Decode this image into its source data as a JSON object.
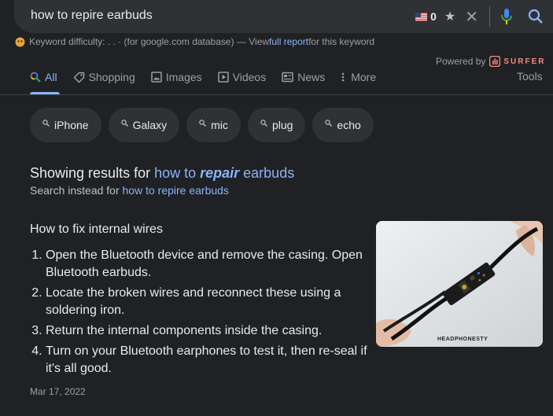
{
  "search": {
    "query": "how to repire earbuds",
    "keyword_count": "0"
  },
  "keyword_bar": {
    "prefix": "Keyword difficulty: . . · (for google.com database) — View ",
    "link": "full report",
    "suffix": " for this keyword"
  },
  "powered": {
    "label": "Powered by",
    "brand": "SURFER"
  },
  "tabs": [
    {
      "label": "All",
      "icon": "search-icon",
      "active": true
    },
    {
      "label": "Shopping",
      "icon": "tag-icon"
    },
    {
      "label": "Images",
      "icon": "image-icon"
    },
    {
      "label": "Videos",
      "icon": "play-icon"
    },
    {
      "label": "News",
      "icon": "news-icon"
    },
    {
      "label": "More",
      "icon": "more-vert-icon"
    }
  ],
  "tools_label": "Tools",
  "chips": [
    {
      "label": "iPhone"
    },
    {
      "label": "Galaxy"
    },
    {
      "label": "mic"
    },
    {
      "label": "plug"
    },
    {
      "label": "echo"
    }
  ],
  "correction": {
    "showing_prefix": "Showing results for ",
    "corrected_pre": "how to ",
    "corrected_bold": "repair",
    "corrected_post": " earbuds",
    "instead_prefix": "Search instead for ",
    "instead_link": "how to repire earbuds"
  },
  "snippet": {
    "title": "How to fix internal wires",
    "steps": [
      "Open the Bluetooth device and remove the casing. Open Bluetooth earbuds.",
      "Locate the broken wires and reconnect these using a soldering iron.",
      "Return the internal components inside the casing.",
      "Turn on your Bluetooth earphones to test it, then re-seal if it's all good."
    ],
    "date": "Mar 17, 2022",
    "image_watermark": "HEADPHONESTY"
  },
  "colors": {
    "background": "#202124",
    "link": "#8ab4f8",
    "muted": "#9aa0a6",
    "chip": "#303134"
  }
}
